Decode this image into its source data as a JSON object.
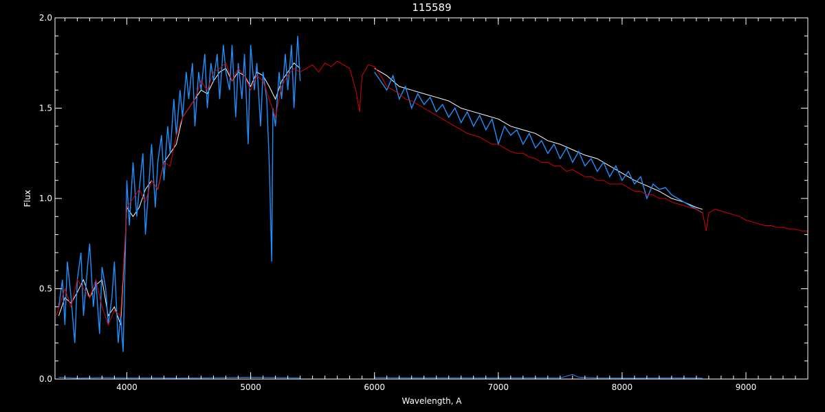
{
  "chart_data": {
    "type": "line",
    "title": "115589",
    "xlabel": "Wavelength, A",
    "ylabel": "Flux",
    "xlim": [
      3420,
      9500
    ],
    "ylim": [
      0,
      2.0
    ],
    "x_ticks": [
      4000,
      5000,
      6000,
      7000,
      8000,
      9000
    ],
    "x_tick_labels": [
      "4000",
      "5000",
      "6000",
      "7000",
      "8000",
      "9000"
    ],
    "y_ticks": [
      0,
      0.5,
      1.0,
      1.5,
      2.0
    ],
    "y_tick_labels": [
      "0.0",
      "0.5",
      "1.0",
      "1.5",
      "2.0"
    ],
    "x_minor_step": 100,
    "y_minor_step": 0.1,
    "grid": false,
    "background": "#000000",
    "series": [
      {
        "role": "observed spectrum (white)",
        "color": "#ffffff",
        "segments": [
          {
            "x": [
              3450,
              3500,
              3550,
              3600,
              3650,
              3700,
              3750,
              3800,
              3850,
              3900,
              3950,
              4000,
              4050,
              4100,
              4150,
              4200,
              4250,
              4300,
              4350,
              4400,
              4450,
              4500,
              4550,
              4600,
              4650,
              4700,
              4750,
              4800,
              4850,
              4900,
              4950,
              5000,
              5050,
              5100,
              5150,
              5200,
              5250,
              5300,
              5350,
              5400
            ],
            "y": [
              0.35,
              0.45,
              0.42,
              0.48,
              0.55,
              0.45,
              0.52,
              0.55,
              0.35,
              0.4,
              0.3,
              0.95,
              0.9,
              0.95,
              1.05,
              1.1,
              1.05,
              1.2,
              1.25,
              1.3,
              1.45,
              1.5,
              1.55,
              1.6,
              1.58,
              1.65,
              1.7,
              1.72,
              1.65,
              1.7,
              1.68,
              1.62,
              1.7,
              1.68,
              1.62,
              1.55,
              1.65,
              1.7,
              1.75,
              1.72
            ]
          },
          {
            "x": [
              6000,
              6100,
              6200,
              6300,
              6400,
              6500,
              6600,
              6700,
              6800,
              6900,
              7000,
              7100,
              7200,
              7300,
              7400,
              7500,
              7600,
              7700,
              7800,
              7900,
              8000,
              8100,
              8200,
              8300,
              8400,
              8500,
              8600,
              8650
            ],
            "y": [
              1.72,
              1.68,
              1.62,
              1.6,
              1.58,
              1.56,
              1.54,
              1.5,
              1.48,
              1.46,
              1.44,
              1.4,
              1.38,
              1.36,
              1.32,
              1.3,
              1.27,
              1.24,
              1.22,
              1.18,
              1.14,
              1.1,
              1.07,
              1.04,
              1.0,
              0.98,
              0.95,
              0.94
            ]
          }
        ]
      },
      {
        "role": "observed spectrum (blue)",
        "color": "#1e90ff",
        "segments": [
          {
            "x": [
              3450,
              3480,
              3500,
              3520,
              3550,
              3580,
              3600,
              3630,
              3650,
              3680,
              3700,
              3730,
              3750,
              3780,
              3800,
              3830,
              3850,
              3880,
              3900,
              3930,
              3950,
              3970,
              4000,
              4020,
              4050,
              4080,
              4100,
              4130,
              4150,
              4180,
              4200,
              4230,
              4250,
              4280,
              4300,
              4330,
              4350,
              4380,
              4400,
              4430,
              4450,
              4480,
              4500,
              4530,
              4550,
              4580,
              4600,
              4630,
              4650,
              4680,
              4700,
              4730,
              4750,
              4780,
              4800,
              4830,
              4850,
              4880,
              4900,
              4930,
              4950,
              4980,
              5000,
              5030,
              5050,
              5080,
              5100,
              5130,
              5150,
              5170,
              5180,
              5200,
              5230,
              5250,
              5280,
              5300,
              5330,
              5350,
              5380,
              5400
            ],
            "y": [
              0.4,
              0.55,
              0.3,
              0.65,
              0.45,
              0.2,
              0.55,
              0.7,
              0.35,
              0.6,
              0.75,
              0.4,
              0.55,
              0.25,
              0.62,
              0.5,
              0.3,
              0.45,
              0.65,
              0.2,
              0.35,
              0.15,
              1.1,
              0.85,
              1.2,
              0.9,
              1.05,
              1.25,
              0.8,
              1.1,
              1.3,
              0.95,
              1.2,
              1.35,
              1.1,
              1.4,
              1.25,
              1.55,
              1.35,
              1.6,
              1.45,
              1.7,
              1.55,
              1.75,
              1.4,
              1.7,
              1.6,
              1.8,
              1.5,
              1.75,
              1.65,
              1.8,
              1.55,
              1.85,
              1.7,
              1.6,
              1.85,
              1.45,
              1.75,
              1.55,
              1.8,
              1.3,
              1.85,
              1.6,
              1.75,
              1.4,
              1.7,
              1.55,
              1.2,
              0.65,
              1.5,
              1.4,
              1.7,
              1.55,
              1.8,
              1.6,
              1.85,
              1.5,
              1.9,
              1.65
            ]
          },
          {
            "x": [
              6000,
              6050,
              6100,
              6150,
              6200,
              6250,
              6300,
              6350,
              6400,
              6450,
              6500,
              6550,
              6600,
              6650,
              6700,
              6750,
              6800,
              6850,
              6900,
              6950,
              7000,
              7050,
              7100,
              7150,
              7200,
              7250,
              7300,
              7350,
              7400,
              7450,
              7500,
              7550,
              7600,
              7650,
              7700,
              7750,
              7800,
              7850,
              7900,
              7950,
              8000,
              8050,
              8100,
              8150,
              8200,
              8250,
              8300,
              8350,
              8400,
              8450,
              8500,
              8550,
              8600,
              8650
            ],
            "y": [
              1.7,
              1.65,
              1.6,
              1.68,
              1.55,
              1.62,
              1.5,
              1.58,
              1.52,
              1.56,
              1.48,
              1.52,
              1.45,
              1.5,
              1.42,
              1.48,
              1.4,
              1.46,
              1.38,
              1.44,
              1.3,
              1.4,
              1.35,
              1.38,
              1.3,
              1.36,
              1.28,
              1.32,
              1.25,
              1.3,
              1.22,
              1.28,
              1.2,
              1.26,
              1.18,
              1.22,
              1.15,
              1.2,
              1.12,
              1.18,
              1.1,
              1.15,
              1.08,
              1.12,
              1.0,
              1.08,
              1.05,
              1.06,
              1.02,
              1.0,
              0.98,
              0.96,
              0.94,
              0.92
            ]
          }
        ]
      },
      {
        "role": "model spectrum (red)",
        "color": "#dd0000",
        "segments": [
          {
            "x": [
              3430,
              3500,
              3550,
              3600,
              3650,
              3700,
              3750,
              3800,
              3850,
              3900,
              3950,
              4000,
              4050,
              4100,
              4150,
              4200,
              4250,
              4300,
              4350,
              4400,
              4450,
              4500,
              4550,
              4600,
              4650,
              4700,
              4750,
              4800,
              4850,
              4900,
              4950,
              5000,
              5050,
              5100,
              5150,
              5200,
              5250,
              5300,
              5350,
              5400,
              5450,
              5500,
              5550,
              5600,
              5650,
              5700,
              5750,
              5800,
              5850,
              5880,
              5900,
              5950,
              6000,
              6050,
              6100,
              6150,
              6200,
              6250,
              6300,
              6350,
              6400,
              6450,
              6500,
              6550,
              6600,
              6650,
              6700,
              6750,
              6800,
              6850,
              6900,
              6950,
              7000,
              7050,
              7100,
              7150,
              7200,
              7250,
              7300,
              7350,
              7400,
              7450,
              7500,
              7550,
              7600,
              7650,
              7700,
              7750,
              7800,
              7850,
              7900,
              7950,
              8000,
              8050,
              8100,
              8150,
              8200,
              8250,
              8300,
              8350,
              8400,
              8450,
              8500,
              8550,
              8600,
              8650,
              8680,
              8700,
              8750,
              8800,
              8850,
              8900,
              8950,
              9000,
              9050,
              9100,
              9150,
              9200,
              9250,
              9300,
              9350,
              9400,
              9450,
              9500
            ],
            "y": [
              0.35,
              0.5,
              0.4,
              0.55,
              0.5,
              0.45,
              0.55,
              0.4,
              0.3,
              0.38,
              0.35,
              0.95,
              1.0,
              1.05,
              0.98,
              1.1,
              1.05,
              1.2,
              1.18,
              1.35,
              1.45,
              1.5,
              1.55,
              1.65,
              1.6,
              1.7,
              1.72,
              1.75,
              1.65,
              1.72,
              1.68,
              1.6,
              1.68,
              1.65,
              1.55,
              1.45,
              1.62,
              1.68,
              1.72,
              1.7,
              1.72,
              1.74,
              1.7,
              1.75,
              1.73,
              1.76,
              1.74,
              1.72,
              1.6,
              1.48,
              1.68,
              1.74,
              1.73,
              1.68,
              1.62,
              1.6,
              1.58,
              1.55,
              1.54,
              1.52,
              1.5,
              1.48,
              1.46,
              1.44,
              1.42,
              1.4,
              1.38,
              1.36,
              1.35,
              1.34,
              1.32,
              1.3,
              1.3,
              1.28,
              1.26,
              1.25,
              1.25,
              1.23,
              1.22,
              1.2,
              1.2,
              1.18,
              1.18,
              1.15,
              1.16,
              1.14,
              1.12,
              1.12,
              1.1,
              1.1,
              1.08,
              1.08,
              1.08,
              1.06,
              1.04,
              1.04,
              1.02,
              1.02,
              1.0,
              1.0,
              0.98,
              0.97,
              0.96,
              0.95,
              0.94,
              0.92,
              0.82,
              0.92,
              0.94,
              0.93,
              0.92,
              0.91,
              0.9,
              0.88,
              0.87,
              0.86,
              0.85,
              0.85,
              0.84,
              0.84,
              0.83,
              0.83,
              0.82,
              0.82
            ]
          }
        ]
      },
      {
        "role": "flux error (blue, near zero)",
        "color": "#1e90ff",
        "segments": [
          {
            "x": [
              3450,
              3600,
              3800,
              4000,
              4200,
              4400,
              4600,
              4800,
              5000,
              5200,
              5400
            ],
            "y": [
              0.01,
              0.005,
              0.008,
              0.006,
              0.007,
              0.005,
              0.006,
              0.008,
              0.01,
              0.008,
              0.006
            ]
          },
          {
            "x": [
              6000,
              6300,
              6600,
              6900,
              7200,
              7500,
              7600,
              7650,
              7800,
              8100,
              8400,
              8650
            ],
            "y": [
              0.008,
              0.006,
              0.007,
              0.006,
              0.007,
              0.006,
              0.025,
              0.01,
              0.006,
              0.005,
              0.006,
              0.005
            ]
          }
        ]
      }
    ]
  }
}
